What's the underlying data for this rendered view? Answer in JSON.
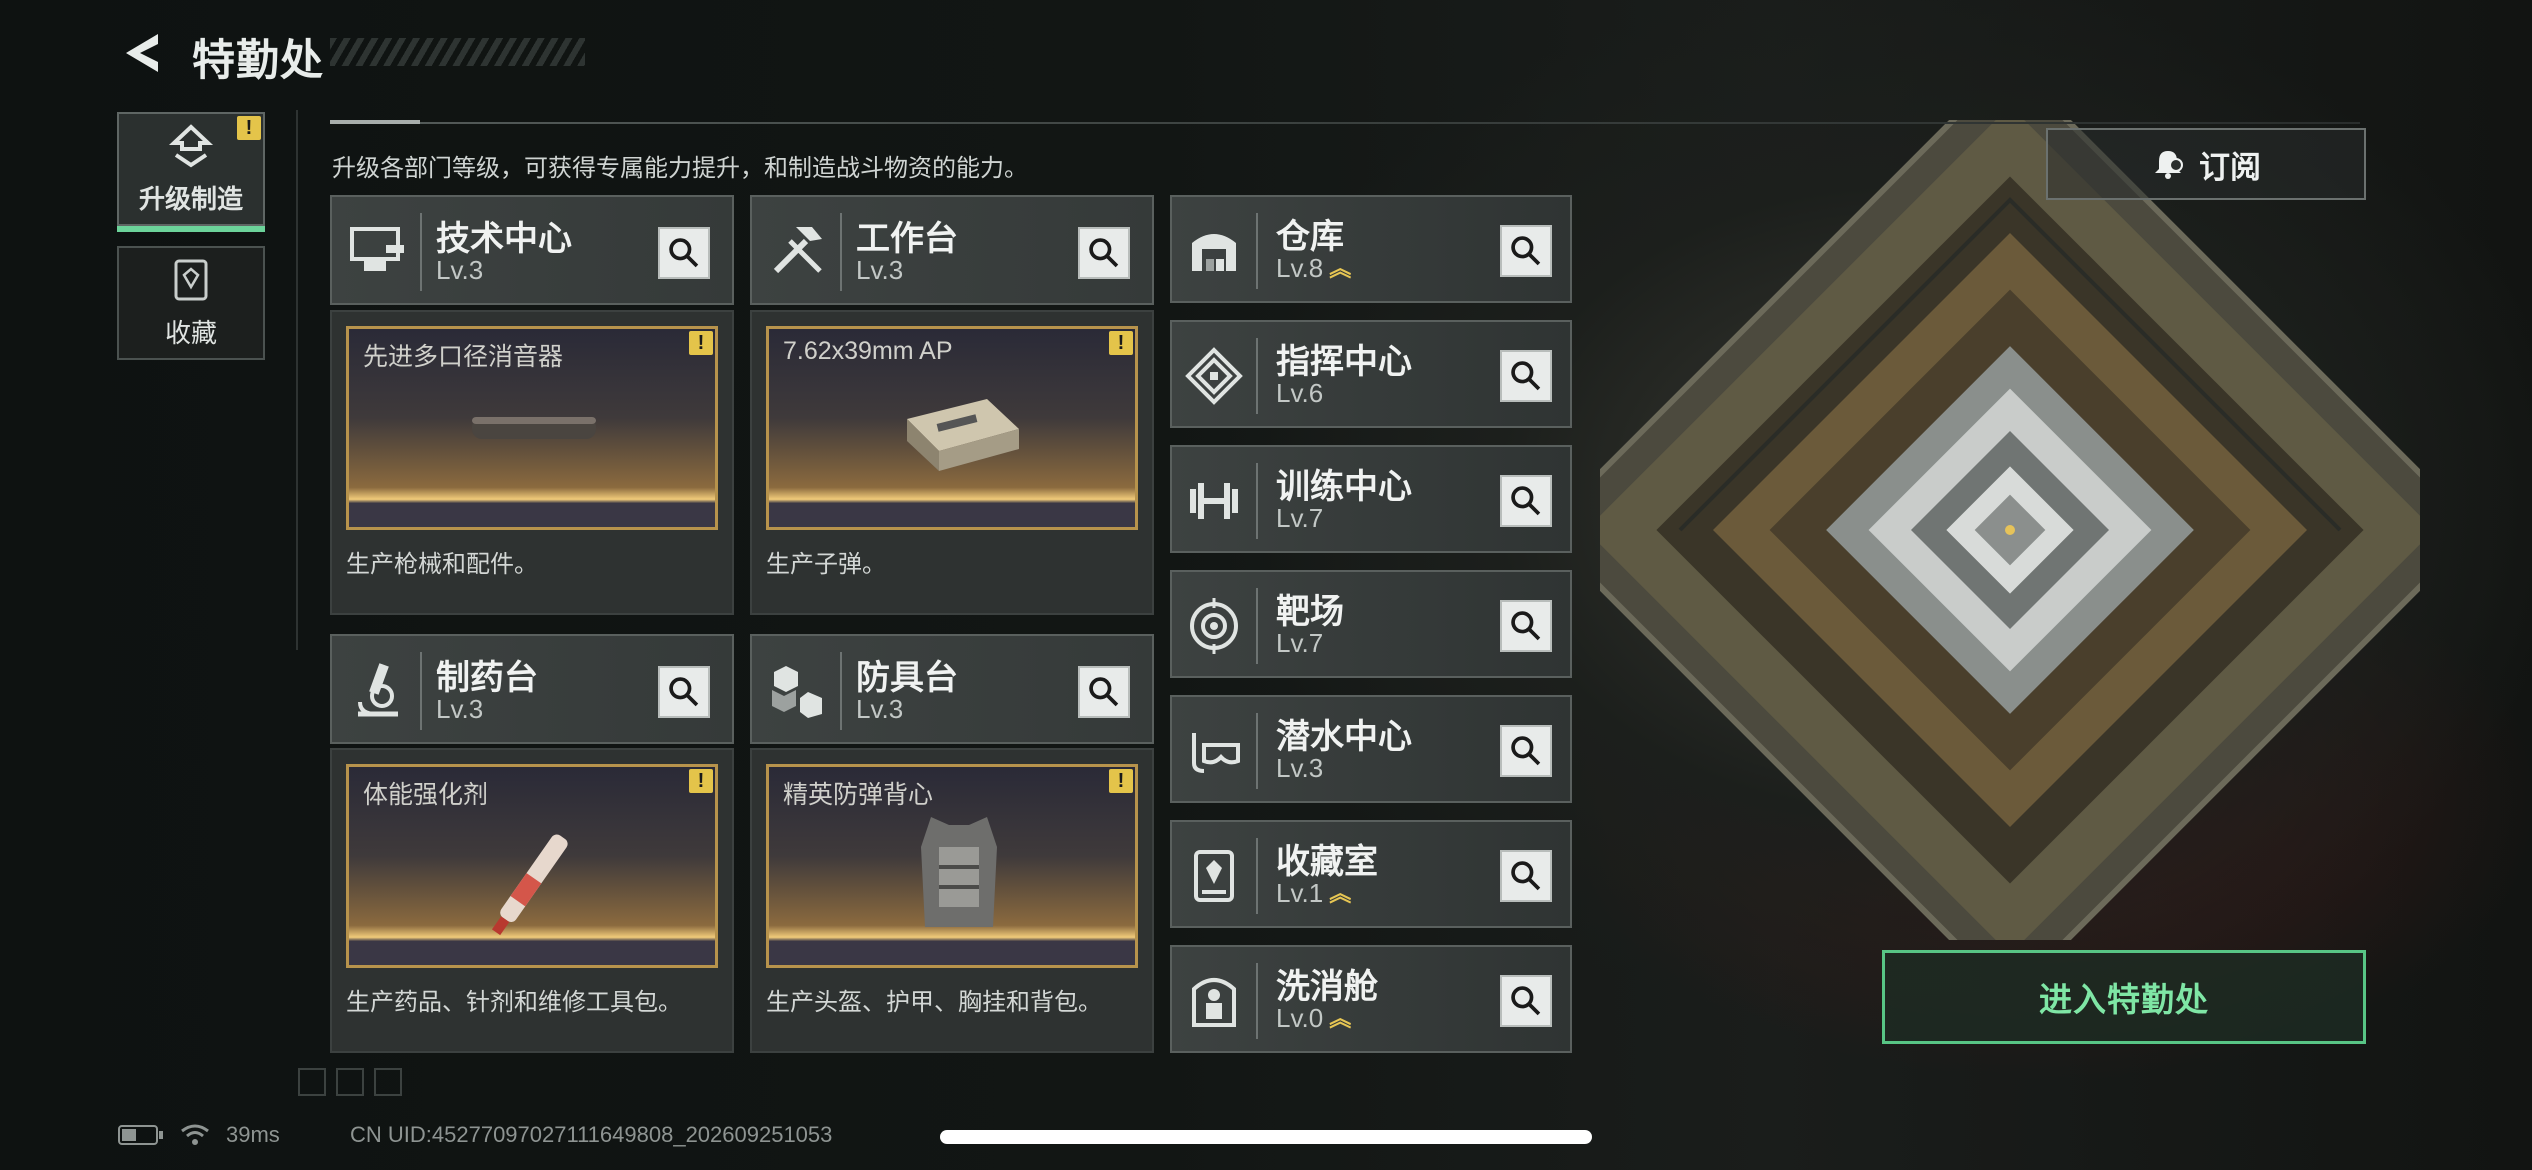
{
  "header": {
    "title": "特勤处",
    "subtitle": "升级各部门等级，可获得专属能力提升，和制造战斗物资的能力。",
    "subscribe_label": "订阅"
  },
  "sidebar": {
    "tabs": [
      {
        "label": "升级制造",
        "icon": "upgrade-icon",
        "active": true,
        "badge": "!"
      },
      {
        "label": "收藏",
        "icon": "collection-icon",
        "active": false
      }
    ]
  },
  "stations": [
    {
      "name": "技术中心",
      "level": "Lv.3",
      "icon": "tech-center-icon",
      "product": "先进多口径消音器",
      "desc": "生产枪械和配件。",
      "badge": "!"
    },
    {
      "name": "工作台",
      "level": "Lv.3",
      "icon": "workbench-icon",
      "product": "7.62x39mm AP",
      "desc": "生产子弹。",
      "badge": "!"
    },
    {
      "name": "制药台",
      "level": "Lv.3",
      "icon": "pharmacy-icon",
      "product": "体能强化剂",
      "desc": "生产药品、针剂和维修工具包。",
      "badge": "!"
    },
    {
      "name": "防具台",
      "level": "Lv.3",
      "icon": "armor-bench-icon",
      "product": "精英防弹背心",
      "desc": "生产头盔、护甲、胸挂和背包。",
      "badge": "!"
    }
  ],
  "facilities": [
    {
      "name": "仓库",
      "level": "Lv.8",
      "upgradable": true,
      "icon": "warehouse-icon"
    },
    {
      "name": "指挥中心",
      "level": "Lv.6",
      "upgradable": false,
      "icon": "command-center-icon"
    },
    {
      "name": "训练中心",
      "level": "Lv.7",
      "upgradable": false,
      "icon": "training-center-icon"
    },
    {
      "name": "靶场",
      "level": "Lv.7",
      "upgradable": false,
      "icon": "shooting-range-icon"
    },
    {
      "name": "潜水中心",
      "level": "Lv.3",
      "upgradable": false,
      "icon": "diving-center-icon"
    },
    {
      "name": "收藏室",
      "level": "Lv.1",
      "upgradable": true,
      "icon": "collection-room-icon"
    },
    {
      "name": "洗消舱",
      "level": "Lv.0",
      "upgradable": true,
      "icon": "decon-chamber-icon"
    }
  ],
  "enter_button": "进入特勤处",
  "status": {
    "ping": "39ms",
    "uid": "CN UID:4527709702711164​9808_202609251053"
  },
  "colors": {
    "accent_green": "#58c585",
    "warn_yellow": "#e4c44a",
    "product_gold": "#b7934c"
  }
}
